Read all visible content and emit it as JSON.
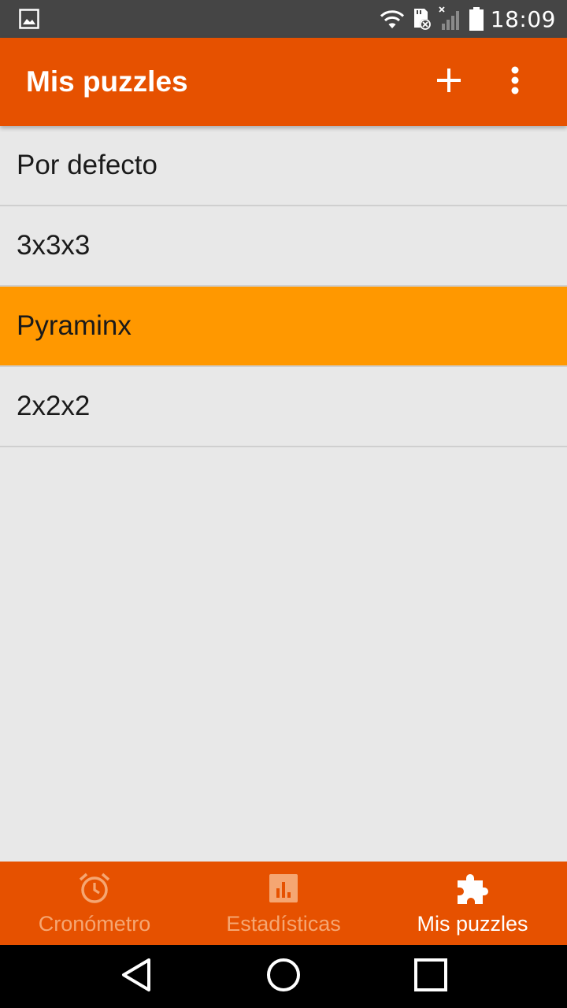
{
  "status_bar": {
    "time": "18:09",
    "icons": [
      "image-notification-icon",
      "wifi-icon",
      "sd-card-error-icon",
      "signal-no-sim-icon",
      "battery-icon"
    ]
  },
  "app_bar": {
    "title": "Mis puzzles",
    "actions": [
      "add-icon",
      "more-vert-icon"
    ]
  },
  "puzzles": {
    "items": [
      {
        "label": "Por defecto",
        "selected": false
      },
      {
        "label": "3x3x3",
        "selected": false
      },
      {
        "label": "Pyraminx",
        "selected": true
      },
      {
        "label": "2x2x2",
        "selected": false
      }
    ]
  },
  "bottom_nav": {
    "items": [
      {
        "label": "Cronómetro",
        "icon": "alarm-clock-icon",
        "active": false
      },
      {
        "label": "Estadísticas",
        "icon": "bar-chart-icon",
        "active": false
      },
      {
        "label": "Mis puzzles",
        "icon": "puzzle-piece-icon",
        "active": true
      }
    ]
  },
  "system_nav": [
    "back-icon",
    "home-icon",
    "recents-icon"
  ],
  "colors": {
    "primary": "#e65100",
    "selected_item": "#ff9800",
    "background": "#e8e8e8",
    "status_bar": "#454545"
  }
}
